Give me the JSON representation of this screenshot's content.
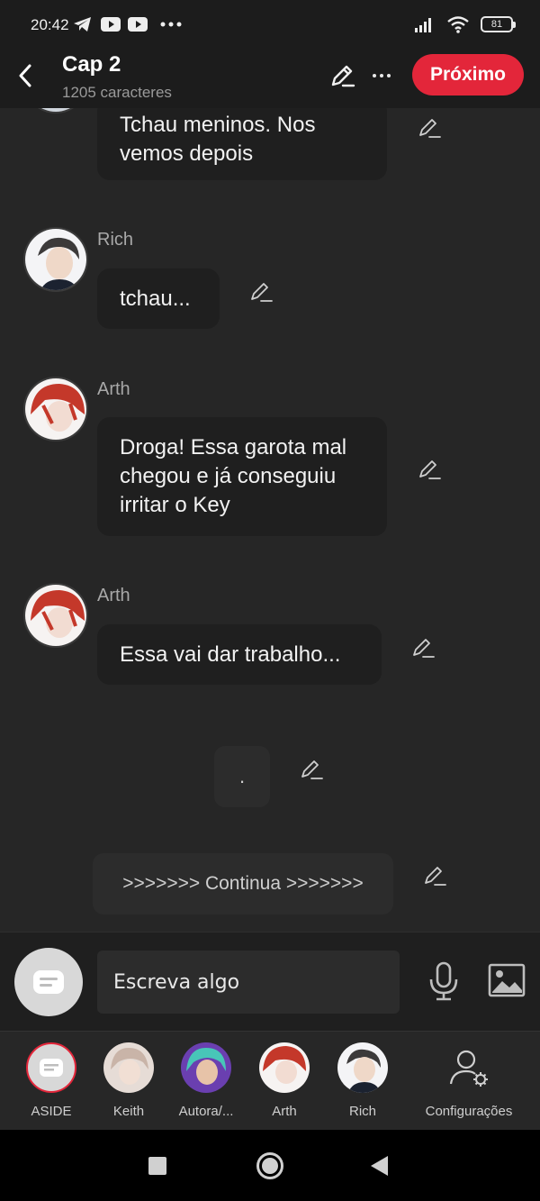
{
  "status_bar": {
    "time": "20:42",
    "battery": "81"
  },
  "header": {
    "title": "Cap 2",
    "subtitle": "1205 caracteres",
    "next_label": "Próximo"
  },
  "messages": [
    {
      "text": "Tchau meninos. Nos vemos depois"
    },
    {
      "name": "Rich",
      "text": "tchau..."
    },
    {
      "name": "Arth",
      "text": "Droga! Essa garota mal chegou e já conseguiu irritar o Key"
    },
    {
      "name": "Arth",
      "text": "Essa vai dar trabalho..."
    },
    {
      "text": "."
    },
    {
      "text": ">>>>>>> Continua >>>>>>>"
    }
  ],
  "input": {
    "placeholder": "Escreva algo"
  },
  "characters": [
    {
      "label": "ASIDE"
    },
    {
      "label": "Keith"
    },
    {
      "label": "Autora/..."
    },
    {
      "label": "Arth"
    },
    {
      "label": "Rich"
    },
    {
      "label": "Configurações"
    }
  ],
  "colors": {
    "accent": "#e3263a",
    "background": "#262626",
    "bubble": "#1f1f1f"
  }
}
